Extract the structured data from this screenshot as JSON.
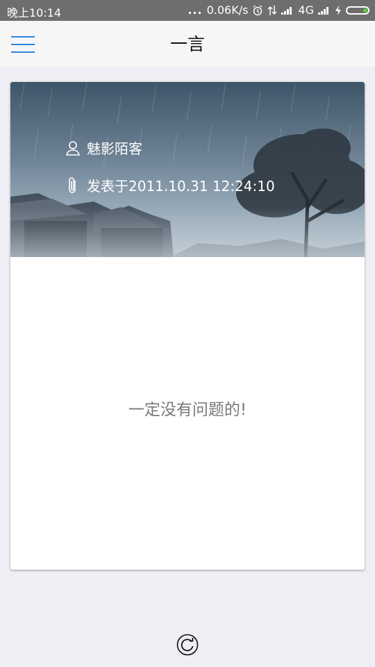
{
  "status_bar": {
    "time": "晚上10:14",
    "dots": "...",
    "speed": "0.06K/s",
    "network": "4G",
    "icons": [
      "alarm-icon",
      "data-transfer-icon",
      "signal-icon",
      "signal-icon",
      "charging-icon",
      "battery-icon"
    ]
  },
  "app_bar": {
    "title": "一言",
    "menu_icon": "hamburger-menu-icon"
  },
  "card": {
    "author": "魅影陌客",
    "author_icon": "user-icon",
    "date_text": "发表于2011.10.31 12:24:10",
    "date_icon": "paperclip-icon",
    "quote": "一定没有问题的!"
  },
  "footer": {
    "refresh_icon": "refresh-icon"
  },
  "colors": {
    "accent": "#2b86d8",
    "status_bar": "#6e6e6e",
    "background": "#eeeef4",
    "quote_text": "#7a7a7a"
  }
}
